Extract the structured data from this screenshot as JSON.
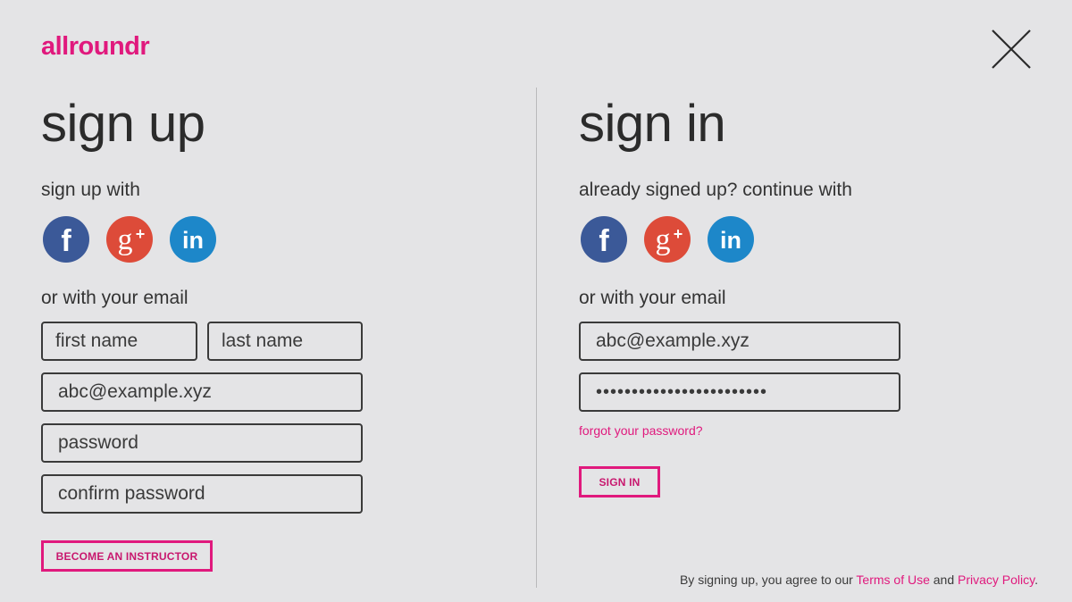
{
  "brand": {
    "logo_text": "allroundr",
    "accent_color": "#e0197d"
  },
  "close": {
    "icon": "close-icon"
  },
  "signup": {
    "title": "sign up",
    "with_label": "sign up with",
    "email_label": "or with your email",
    "social": [
      {
        "name": "facebook-icon",
        "color": "#3b5998"
      },
      {
        "name": "google-plus-icon",
        "color": "#dd4b39"
      },
      {
        "name": "linkedin-icon",
        "color": "#1d87c9"
      }
    ],
    "first_name_placeholder": "first name",
    "last_name_placeholder": "last name",
    "email_value": "abc@example.xyz",
    "password_placeholder": "password",
    "confirm_password_placeholder": "confirm password",
    "instructor_button": "BECOME AN INSTRUCTOR"
  },
  "signin": {
    "title": "sign in",
    "with_label": "already signed up? continue with",
    "email_label": "or with your email",
    "social": [
      {
        "name": "facebook-icon",
        "color": "#3b5998"
      },
      {
        "name": "google-plus-icon",
        "color": "#dd4b39"
      },
      {
        "name": "linkedin-icon",
        "color": "#1d87c9"
      }
    ],
    "email_value": "abc@example.xyz",
    "password_value": "••••••••••••••••••••••••",
    "forgot_link": "forgot your password?",
    "signin_button": "SIGN IN"
  },
  "legal": {
    "prefix": "By signing up, you agree to our ",
    "terms": "Terms of Use",
    "middle": " and ",
    "privacy": "Privacy Policy",
    "suffix": "."
  }
}
